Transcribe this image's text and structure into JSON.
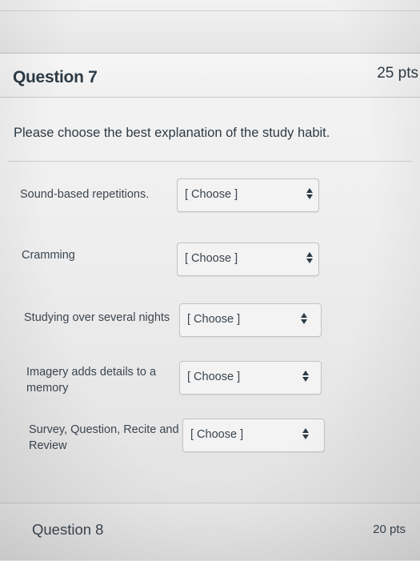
{
  "question7": {
    "title": "Question 7",
    "points": "25 pts",
    "prompt": "Please choose the best explanation of the study habit.",
    "items": [
      {
        "label": "Sound-based repetitions.",
        "selected": "[ Choose ]"
      },
      {
        "label": "Cramming",
        "selected": "[ Choose ]"
      },
      {
        "label": "Studying over several nights",
        "selected": "[ Choose ]"
      },
      {
        "label_line1": "Imagery adds details to a",
        "label_line2": "memory",
        "selected": "[ Choose ]"
      },
      {
        "label_line1": "Survey, Question, Recite and",
        "label_line2": "Review",
        "selected": "[ Choose ]"
      }
    ]
  },
  "question8": {
    "title": "Question 8",
    "points": "20 pts"
  },
  "icons": {
    "select_arrows": "up-down-caret-icon"
  },
  "colors": {
    "text": "#2d3b45",
    "card_bg": "#f1f1f1",
    "select_bg": "#f3f3f3",
    "border": "#c4c4c4"
  }
}
